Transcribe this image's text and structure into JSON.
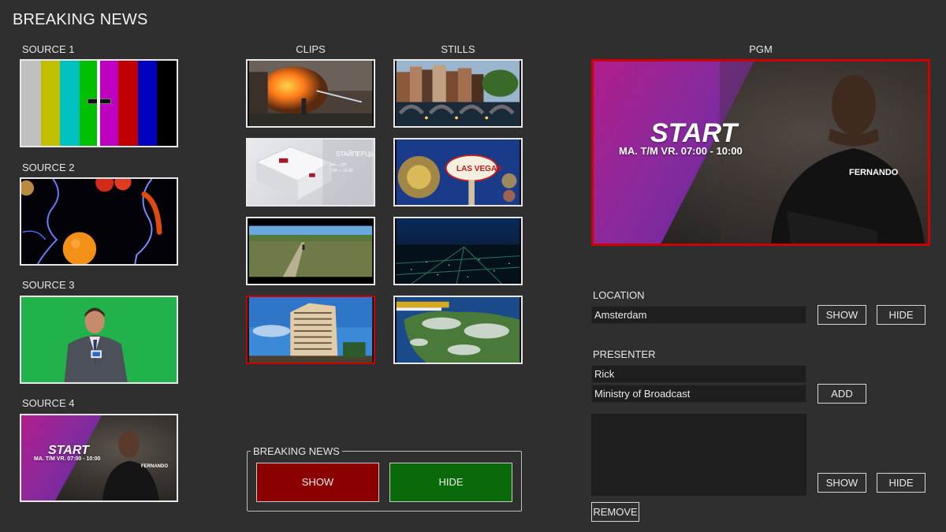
{
  "app": {
    "title": "BREAKING NEWS"
  },
  "sources": [
    {
      "label": "SOURCE 1"
    },
    {
      "label": "SOURCE 2"
    },
    {
      "label": "SOURCE 3"
    },
    {
      "label": "SOURCE 4"
    }
  ],
  "clips": {
    "label": "CLIPS"
  },
  "stills": {
    "label": "STILLS"
  },
  "pgm": {
    "label": "PGM"
  },
  "promo": {
    "headline": "START",
    "schedule": "MA. T/M VR. 07:00 - 10:00",
    "name": "FERNANDO"
  },
  "clip2_overlay": {
    "title": "STAЙПЕРЦЫ",
    "days": "ПН — ПТ",
    "time": "7:00 — 11:00"
  },
  "still2_overlay": {
    "sign": "LAS VEGAS"
  },
  "breaking_news": {
    "legend": "BREAKING NEWS",
    "show_label": "SHOW",
    "hide_label": "HIDE"
  },
  "location": {
    "label": "LOCATION",
    "value": "Amsterdam",
    "show_label": "SHOW",
    "hide_label": "HIDE"
  },
  "presenter": {
    "label": "PRESENTER",
    "name_value": "Rick",
    "org_value": "Ministry of Broadcast",
    "add_label": "ADD",
    "show_label": "SHOW",
    "hide_label": "HIDE",
    "remove_label": "REMOVE"
  },
  "colors": {
    "background": "#2f2f2f",
    "selected_border": "#d00000",
    "show_button": "#8b0000",
    "hide_button": "#0a6a0a"
  }
}
